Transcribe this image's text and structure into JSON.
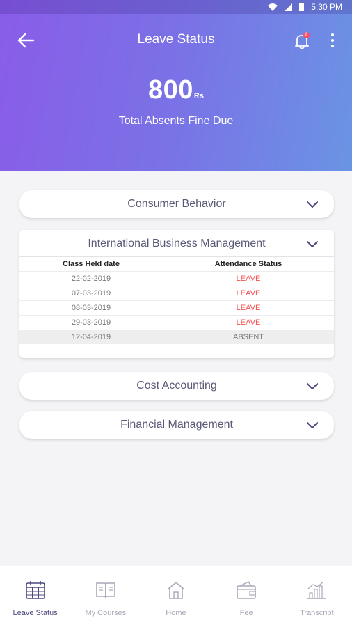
{
  "status_bar": {
    "time": "5:30 PM"
  },
  "header": {
    "title": "Leave Status",
    "notification_count": "8",
    "amount": "800",
    "amount_unit": "Rs",
    "subtitle": "Total Absents Fine Due"
  },
  "courses": [
    {
      "name": "Consumer Behavior",
      "expanded": false
    },
    {
      "name": "International Business Management",
      "expanded": true,
      "table": {
        "headers": [
          "Class Held date",
          "Attendance Status"
        ],
        "rows": [
          {
            "date": "22-02-2019",
            "status": "LEAVE"
          },
          {
            "date": "07-03-2019",
            "status": "LEAVE"
          },
          {
            "date": "08-03-2019",
            "status": "LEAVE"
          },
          {
            "date": "29-03-2019",
            "status": "LEAVE"
          },
          {
            "date": "12-04-2019",
            "status": "ABSENT"
          }
        ]
      }
    },
    {
      "name": "Cost Accounting",
      "expanded": false
    },
    {
      "name": "Financial Management",
      "expanded": false
    }
  ],
  "bottom_nav": [
    {
      "label": "Leave Status",
      "icon": "calendar-icon",
      "active": true
    },
    {
      "label": "My Courses",
      "icon": "book-icon",
      "active": false
    },
    {
      "label": "Home",
      "icon": "home-icon",
      "active": false
    },
    {
      "label": "Fee",
      "icon": "wallet-icon",
      "active": false
    },
    {
      "label": "Transcript",
      "icon": "bar-chart-icon",
      "active": false
    }
  ],
  "colors": {
    "header_gradient_start": "#8a5ce8",
    "header_gradient_end": "#6a94e4",
    "leave_status": "#f25252",
    "active_nav": "#4c4a7e"
  }
}
